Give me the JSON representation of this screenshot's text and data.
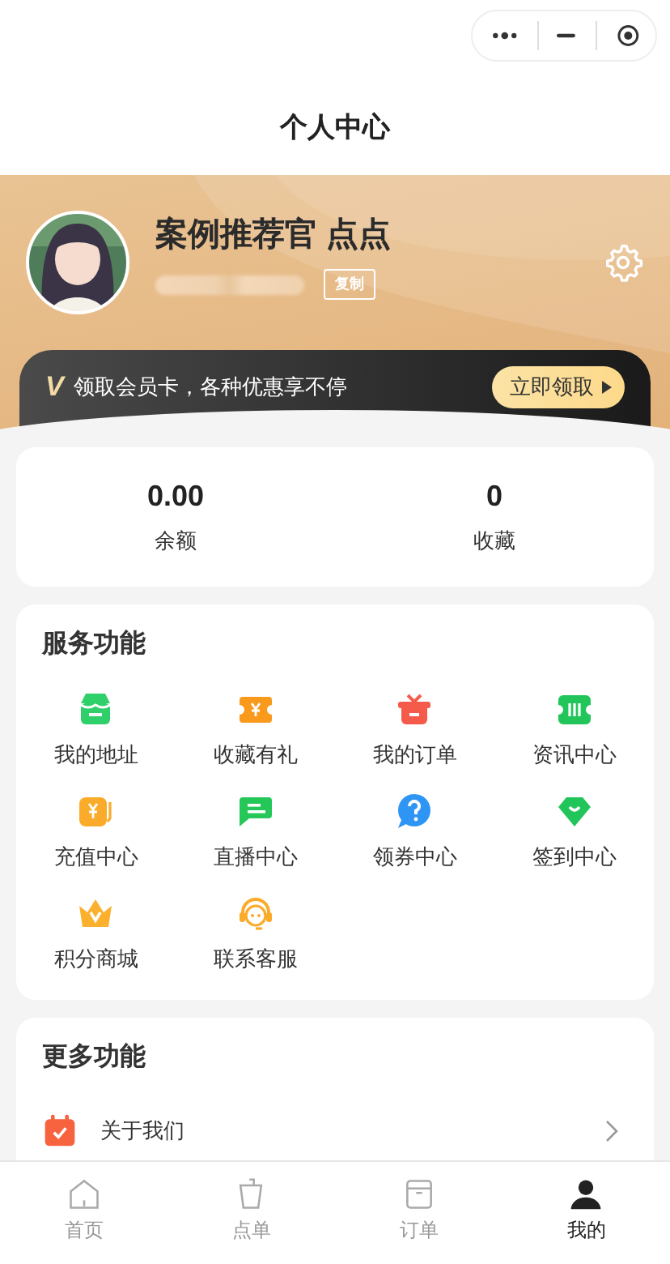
{
  "nav_bar": {
    "title": "个人中心"
  },
  "profile": {
    "name": "案例推荐官 点点",
    "copy_button": "复制"
  },
  "member_banner": {
    "icon_letter": "V",
    "text": "领取会员卡，各种优惠享不停",
    "button": "立即领取"
  },
  "stats": [
    {
      "value": "0.00",
      "label": "余额"
    },
    {
      "value": "0",
      "label": "收藏"
    }
  ],
  "services": {
    "title": "服务功能",
    "items": [
      {
        "label": "我的地址",
        "color": "#2fcf6a"
      },
      {
        "label": "收藏有礼",
        "color": "#f99a1c"
      },
      {
        "label": "我的订单",
        "color": "#f55b4a"
      },
      {
        "label": "资讯中心",
        "color": "#22c55a"
      },
      {
        "label": "充值中心",
        "color": "#fbab2a"
      },
      {
        "label": "直播中心",
        "color": "#25c858"
      },
      {
        "label": "领券中心",
        "color": "#2e95f5"
      },
      {
        "label": "签到中心",
        "color": "#22c55a"
      },
      {
        "label": "积分商城",
        "color": "#fbb12e"
      },
      {
        "label": "联系客服",
        "color": "#fbab2a"
      }
    ]
  },
  "more": {
    "title": "更多功能",
    "items": [
      {
        "label": "关于我们",
        "color": "#f7623f"
      }
    ]
  },
  "tab_bar": [
    {
      "label": "首页",
      "selected": false
    },
    {
      "label": "点单",
      "selected": false
    },
    {
      "label": "订单",
      "selected": false
    },
    {
      "label": "我的",
      "selected": true
    }
  ]
}
